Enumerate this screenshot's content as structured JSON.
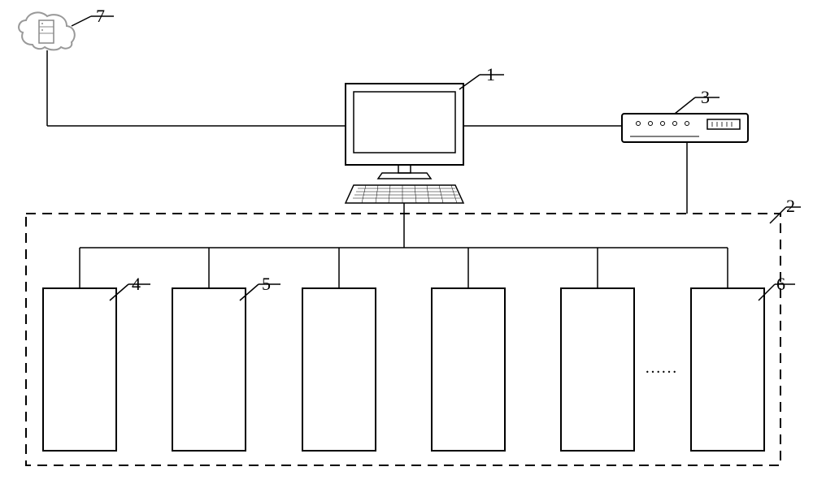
{
  "labels": {
    "l1": "1",
    "l2": "2",
    "l3": "3",
    "l4": "4",
    "l5": "5",
    "l6": "6",
    "l7": "7"
  },
  "ellipsis": "……"
}
